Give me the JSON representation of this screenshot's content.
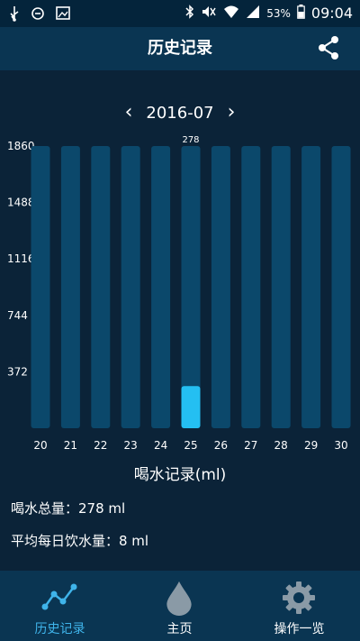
{
  "status_bar": {
    "battery": "53%",
    "time": "09:04",
    "left_icons": [
      "usb-icon",
      "sync-icon",
      "image-icon"
    ],
    "right_icons": [
      "bluetooth-icon",
      "mute-icon",
      "wifi-icon",
      "signal-icon",
      "battery-icon"
    ]
  },
  "header": {
    "title": "历史记录",
    "share_icon": "share-icon"
  },
  "month_nav": {
    "prev": "‹",
    "month": "2016-07",
    "next": "›"
  },
  "chart_data": {
    "type": "bar",
    "categories": [
      "20",
      "21",
      "22",
      "23",
      "24",
      "25",
      "26",
      "27",
      "28",
      "29",
      "30"
    ],
    "values": [
      0,
      0,
      0,
      0,
      0,
      278,
      0,
      0,
      0,
      0,
      0
    ],
    "max_value": 1860,
    "yticks": [
      "1860",
      "1488",
      "1116",
      "744",
      "372"
    ],
    "data_labels": [
      {
        "category": "25",
        "value": "278"
      }
    ],
    "title": "喝水记录(ml)",
    "ylim": [
      0,
      1860
    ],
    "colors": {
      "track": "#0b486b",
      "bar": "#24bff2",
      "background": "#0b2338"
    }
  },
  "stats": {
    "total": "喝水总量：278 ml",
    "average": "平均每日饮水量：8 ml"
  },
  "bottom_nav": {
    "items": [
      {
        "label": "历史记录",
        "icon": "history-chart-icon",
        "active": true,
        "color": "#3fb4ea"
      },
      {
        "label": "主页",
        "icon": "water-drop-icon",
        "active": false,
        "color": "#ffffff"
      },
      {
        "label": "操作一览",
        "icon": "gear-icon",
        "active": false,
        "color": "#ffffff"
      }
    ]
  }
}
